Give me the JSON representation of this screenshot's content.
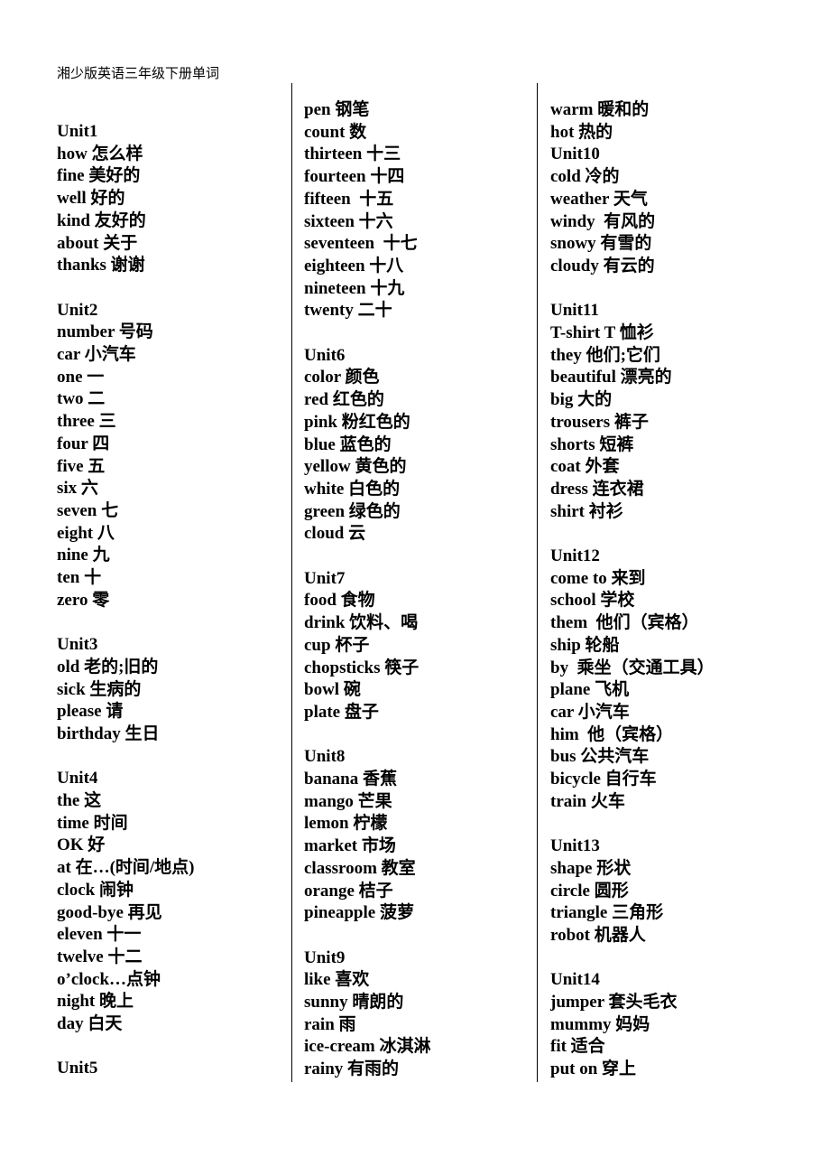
{
  "document": {
    "title": "湘少版英语三年级下册单词"
  },
  "columns": [
    {
      "id": "column-1",
      "lines": [
        "Unit1",
        "how 怎么样",
        "fine 美好的",
        "well 好的",
        "kind 友好的",
        "about 关于",
        "thanks 谢谢",
        "",
        "Unit2",
        "number 号码",
        "car 小汽车",
        "one 一",
        "two 二",
        "three 三",
        "four 四",
        "five 五",
        "six 六",
        "seven 七",
        "eight 八",
        "nine 九",
        "ten 十",
        "zero 零",
        "",
        "Unit3",
        "old 老的;旧的",
        "sick 生病的",
        "please 请",
        "birthday 生日",
        "",
        "Unit4",
        "the 这",
        "time 时间",
        "OK 好",
        "at 在…(时间/地点)",
        "clock 闹钟",
        "good-bye 再见",
        "eleven 十一",
        "twelve 十二",
        "o’clock…点钟",
        "night 晚上",
        "day 白天",
        "",
        "Unit5"
      ]
    },
    {
      "id": "column-2",
      "lines": [
        "pen 钢笔",
        "count 数",
        "thirteen 十三",
        "fourteen 十四",
        "fifteen  十五",
        "sixteen 十六",
        "seventeen  十七",
        "eighteen 十八",
        "nineteen 十九",
        "twenty 二十",
        "",
        "Unit6",
        "color 颜色",
        "red 红色的",
        "pink 粉红色的",
        "blue 蓝色的",
        "yellow 黄色的",
        "white 白色的",
        "green 绿色的",
        "cloud 云",
        "",
        "Unit7",
        "food 食物",
        "drink 饮料、喝",
        "cup 杯子",
        "chopsticks 筷子",
        "bowl 碗",
        "plate 盘子",
        "",
        "Unit8",
        "banana 香蕉",
        "mango 芒果",
        "lemon 柠檬",
        "market 市场",
        "classroom 教室",
        "orange 桔子",
        "pineapple 菠萝",
        "",
        "Unit9",
        "like 喜欢",
        "sunny 晴朗的",
        "rain 雨",
        "ice-cream 冰淇淋",
        "rainy 有雨的"
      ]
    },
    {
      "id": "column-3",
      "lines": [
        "warm 暖和的",
        "hot 热的",
        "Unit10",
        "cold 冷的",
        "weather 天气",
        "windy  有风的",
        "snowy 有雪的",
        "cloudy 有云的",
        "",
        "Unit11",
        "T-shirt T 恤衫",
        "they 他们;它们",
        "beautiful 漂亮的",
        "big 大的",
        "trousers 裤子",
        "shorts 短裤",
        "coat 外套",
        "dress 连衣裙",
        "shirt 衬衫",
        "",
        "Unit12",
        "come to 来到",
        "school 学校",
        "them  他们（宾格）",
        "ship 轮船",
        "by  乘坐（交通工具）",
        "plane 飞机",
        "car 小汽车",
        "him  他（宾格）",
        "bus 公共汽车",
        "bicycle 自行车",
        "train 火车",
        "",
        "Unit13",
        "shape 形状",
        "circle 圆形",
        "triangle 三角形",
        "robot 机器人",
        "",
        "Unit14",
        "jumper 套头毛衣",
        "mummy 妈妈",
        "fit 适合",
        "put on 穿上"
      ]
    }
  ]
}
